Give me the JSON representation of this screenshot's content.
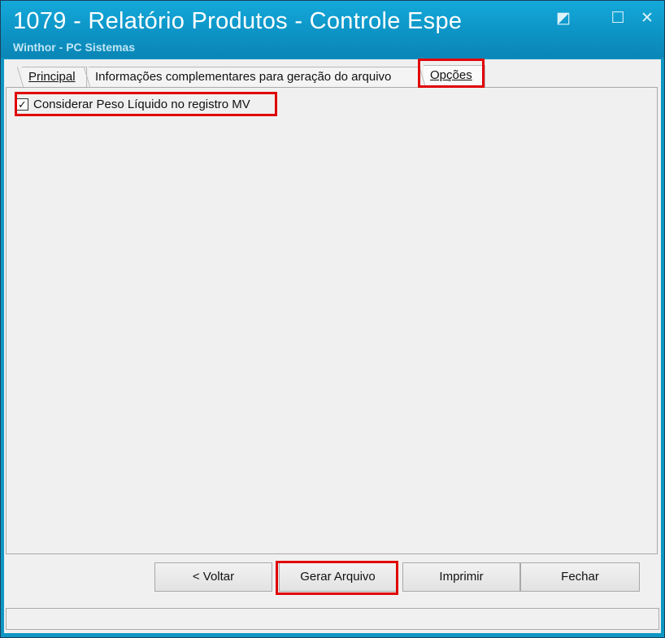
{
  "window": {
    "title": "1079 - Relatório Produtos - Controle Espe",
    "subtitle": "Winthor - PC Sistemas",
    "controls": {
      "restore_glyph": "◩",
      "maximize_glyph": "☐",
      "close_glyph": "✕"
    }
  },
  "tabs": [
    {
      "label": "Principal",
      "active": false
    },
    {
      "label": "Informações complementares para geração do arquivo",
      "active": false
    },
    {
      "label": "Opções",
      "active": true
    }
  ],
  "options": {
    "checkbox_label": "Considerar Peso Líquido no registro MV",
    "checked": true,
    "check_glyph": "✓"
  },
  "buttons": {
    "back": "< Voltar",
    "generate": "Gerar Arquivo",
    "print": "Imprimir",
    "close": "Fechar"
  },
  "status_bar": {
    "text": ""
  },
  "colors": {
    "title_bar": "#0e96c4",
    "highlight": "#e00000"
  }
}
